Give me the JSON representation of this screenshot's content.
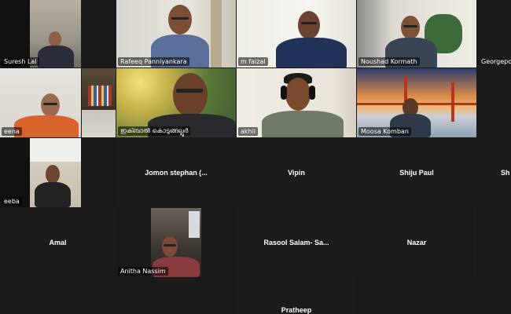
{
  "participants": [
    {
      "name": "Suresh Lal"
    },
    {
      "name": "Rafeeq Panniyankara"
    },
    {
      "name": "m faizal"
    },
    {
      "name": "Noushad Kormath"
    },
    {
      "name": "Georgepok"
    },
    {
      "name": "eena"
    },
    {
      "name": "ഇക്ബാൽ കൊടുങ്ങല്ലൂർ"
    },
    {
      "name": "akhil"
    },
    {
      "name": "Moosa Komban"
    },
    {
      "name": "eeba"
    },
    {
      "name": "Jomon stephan (..."
    },
    {
      "name": "Vipin"
    },
    {
      "name": "Shiju Paul"
    },
    {
      "name": "Sh"
    },
    {
      "name": "Amal"
    },
    {
      "name": "Anitha Nassim"
    },
    {
      "name": "Rasool Salam- Sa..."
    },
    {
      "name": "Nazar"
    },
    {
      "name": "Pratheep"
    }
  ]
}
